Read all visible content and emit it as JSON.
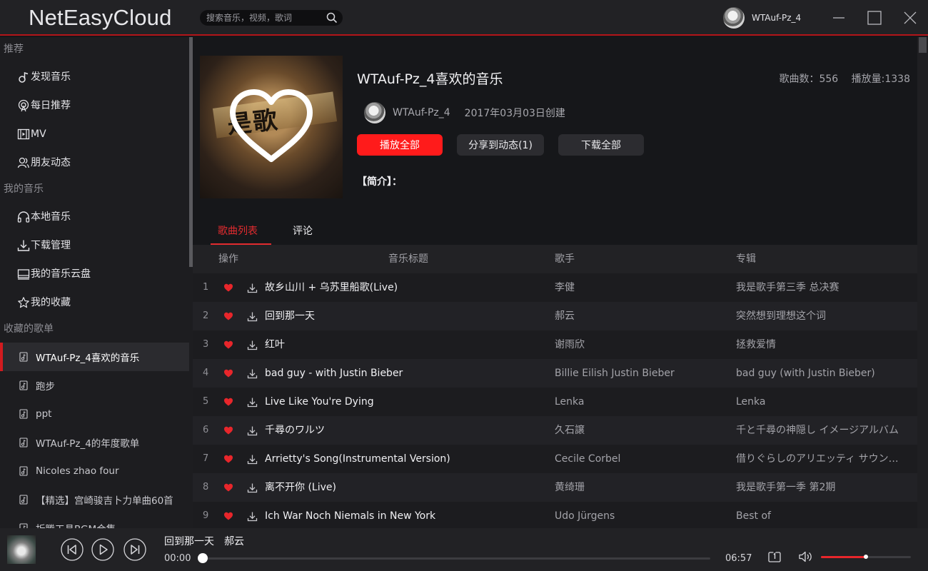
{
  "app": {
    "title": "NetEasyCloud"
  },
  "search": {
    "placeholder": "搜索音乐，视频，歌词"
  },
  "user": {
    "name": "WTAuf-Pz_4"
  },
  "sidebar": {
    "recommend_title": "推荐",
    "recommend_items": [
      {
        "label": "发现音乐",
        "icon": "music-note-icon"
      },
      {
        "label": "每日推荐",
        "icon": "podcast-icon"
      },
      {
        "label": "MV",
        "icon": "film-icon"
      },
      {
        "label": "朋友动态",
        "icon": "friends-icon"
      }
    ],
    "my_music_title": "我的音乐",
    "my_music_items": [
      {
        "label": "本地音乐",
        "icon": "headphones-icon"
      },
      {
        "label": "下载管理",
        "icon": "download-icon"
      },
      {
        "label": "我的音乐云盘",
        "icon": "cloud-drive-icon"
      },
      {
        "label": "我的收藏",
        "icon": "star-icon"
      }
    ],
    "collected_title": "收藏的歌单",
    "playlists": [
      {
        "label": "WTAuf-Pz_4喜欢的音乐",
        "active": true
      },
      {
        "label": "跑步"
      },
      {
        "label": "ppt"
      },
      {
        "label": "WTAuf-Pz_4的年度歌单"
      },
      {
        "label": "Nicoles zhao four"
      },
      {
        "label": "【精选】宫崎骏吉卜力单曲60首"
      },
      {
        "label": "折腾工具BGM合集"
      }
    ]
  },
  "playlist": {
    "title": "WTAuf-Pz_4喜欢的音乐",
    "song_count_label": "歌曲数：",
    "song_count": "556",
    "play_count_label": "播放量:",
    "play_count": "1338",
    "creator": "WTAuf-Pz_4",
    "created": "2017年03月03日创建",
    "play_all": "播放全部",
    "share": "分享到动态(1)",
    "download_all": "下载全部",
    "intro_label": "【简介】：",
    "cover_text": "是歌"
  },
  "tabs": [
    {
      "label": "歌曲列表",
      "active": true
    },
    {
      "label": "评论"
    }
  ],
  "table": {
    "headers": {
      "ops": "操作",
      "title": "音乐标题",
      "artist": "歌手",
      "album": "专辑"
    },
    "rows": [
      {
        "n": "1",
        "title": "故乡山川 + 乌苏里船歌(Live)",
        "artist": "李健",
        "album": "我是歌手第三季 总决赛"
      },
      {
        "n": "2",
        "title": "回到那一天",
        "artist": "郝云",
        "album": "突然想到理想这个词"
      },
      {
        "n": "3",
        "title": "红叶",
        "artist": "谢雨欣",
        "album": "拯救爱情"
      },
      {
        "n": "4",
        "title": "bad guy - with Justin Bieber",
        "artist": "Billie Eilish Justin Bieber",
        "album": "bad guy (with Justin Bieber)"
      },
      {
        "n": "5",
        "title": "Live Like You're Dying",
        "artist": "Lenka",
        "album": "Lenka"
      },
      {
        "n": "6",
        "title": "千尋のワルツ",
        "artist": "久石譲",
        "album": "千と千尋の神隠し イメージアルバム"
      },
      {
        "n": "7",
        "title": "Arrietty's Song(Instrumental Version)",
        "artist": "Cecile Corbel",
        "album": "借りぐらしのアリエッティ サウン…"
      },
      {
        "n": "8",
        "title": "离不开你 (Live)",
        "artist": "黄绮珊",
        "album": "我是歌手第一季 第2期"
      },
      {
        "n": "9",
        "title": "Ich War Noch Niemals in New York",
        "artist": "Udo Jürgens",
        "album": "Best of"
      }
    ]
  },
  "player": {
    "song": "回到那一天",
    "artist": "郝云",
    "current_time": "00:00",
    "total_time": "06:57",
    "progress": 0,
    "volume": 0.5
  },
  "colors": {
    "accent": "#e22b2f",
    "button_red": "#ff1b1b",
    "divider": "#b31519",
    "like": "#e8262b"
  }
}
